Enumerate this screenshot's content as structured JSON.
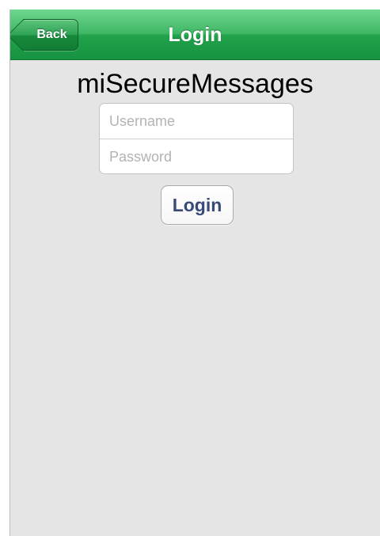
{
  "navbar": {
    "title": "Login",
    "back_label": "Back",
    "accent_color": "#22a24b"
  },
  "main": {
    "app_title": "miSecureMessages",
    "username": {
      "placeholder": "Username",
      "value": ""
    },
    "password": {
      "placeholder": "Password",
      "value": ""
    },
    "login_label": "Login",
    "login_text_color": "#374a78"
  }
}
